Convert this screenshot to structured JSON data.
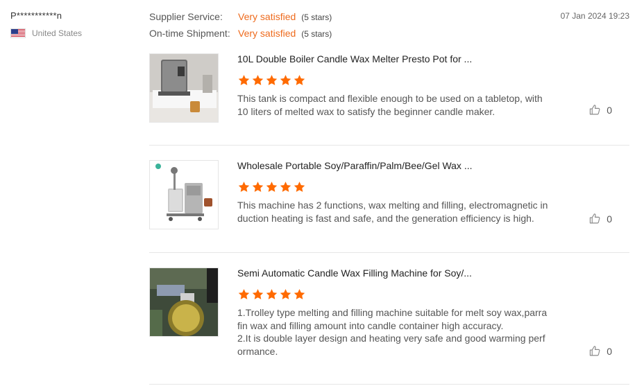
{
  "reviewer": {
    "name": "P***********n",
    "country": "United States",
    "flag_icon": "us-flag-icon"
  },
  "ratings": [
    {
      "label": "Supplier Service:",
      "value": "Very satisfied",
      "stars": "(5 stars)"
    },
    {
      "label": "On-time Shipment:",
      "value": "Very satisfied",
      "stars": "(5 stars)"
    }
  ],
  "date": "07 Jan 2024 19:23",
  "colors": {
    "accent": "#ee6a1c",
    "star": "#ff6a00",
    "divider": "#e6e6e6"
  },
  "items": [
    {
      "title": "10L Double Boiler Candle Wax Melter Presto Pot for ...",
      "rating": 5,
      "text": "This tank is compact and flexible enough to be used on a tabletop, with 10 liters of melted wax to satisfy the beginner candle maker.",
      "likes": "0"
    },
    {
      "title": "Wholesale Portable Soy/Paraffin/Palm/Bee/Gel Wax ...",
      "rating": 5,
      "text": "This machine has 2 functions, wax melting and filling, electromagnetic induction heating is fast and safe, and the generation efficiency is high.",
      "likes": "0"
    },
    {
      "title": "Semi Automatic Candle Wax Filling Machine for Soy/...",
      "rating": 5,
      "text_lines": [
        "1.Trolley type melting and filling machine suitable for melt soy wax,parrafin wax and filling amount into candle container high accuracy.",
        "2.It is double layer design and heating very safe and good warming performance."
      ],
      "likes": "0"
    }
  ]
}
